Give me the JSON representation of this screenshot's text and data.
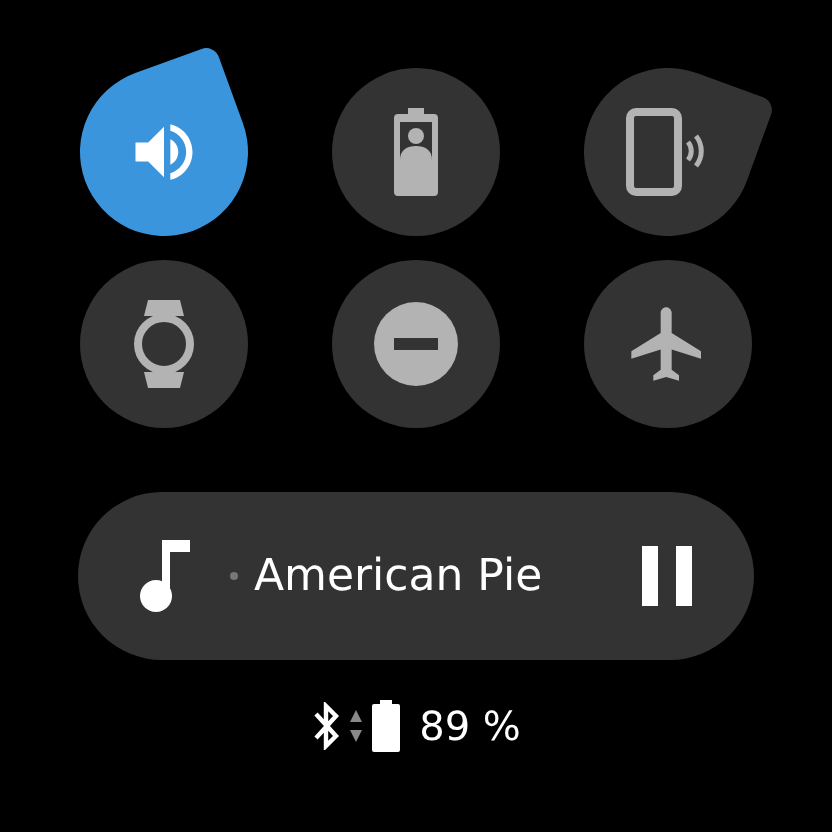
{
  "tiles": [
    {
      "kind": "volume",
      "selected": true
    },
    {
      "kind": "battery-saver",
      "selected": false
    },
    {
      "kind": "phone",
      "selected": false
    },
    {
      "kind": "watch",
      "selected": false
    },
    {
      "kind": "dnd",
      "selected": false
    },
    {
      "kind": "airplane",
      "selected": false
    }
  ],
  "media": {
    "title": "American Pie",
    "playing": true
  },
  "status": {
    "battery": "89 %"
  }
}
